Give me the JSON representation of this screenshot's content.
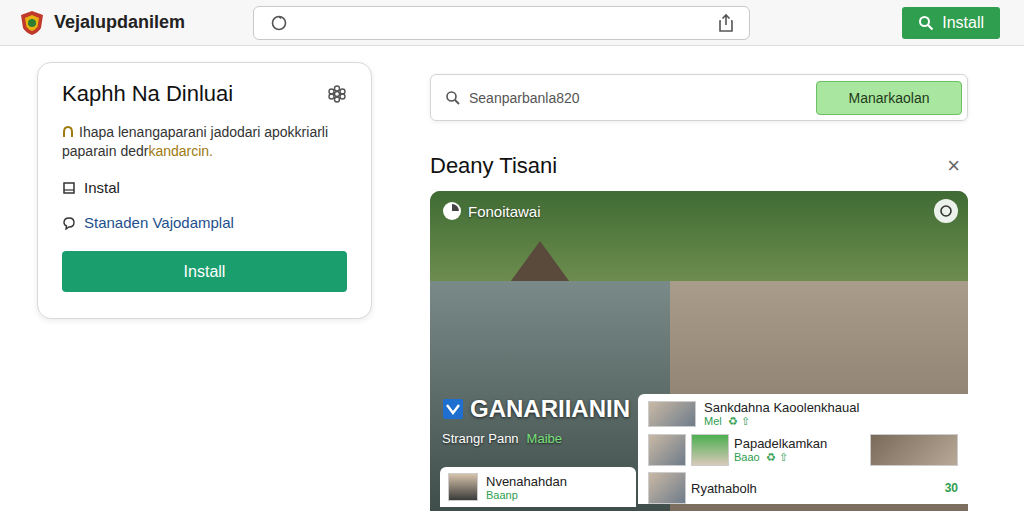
{
  "header": {
    "title": "Vejalupdanilem",
    "install": "Install"
  },
  "promo_card": {
    "title": "Kaphh Na Dinluai",
    "description": "Ihapa lenangaparani jadodari apokkriarli paparain dedr",
    "description_highlight": "kandarcin.",
    "items": [
      {
        "label": "Instal",
        "kind": "box",
        "color": "#222222"
      },
      {
        "label": "Stanaden Vajodamplal",
        "kind": "bubble",
        "color": "#1d4f8c"
      }
    ],
    "button": "Install"
  },
  "search": {
    "placeholder": "Seanparbanla820",
    "button": "Manarkaolan"
  },
  "section": {
    "title": "Deany Tisani",
    "close": "×"
  },
  "feature": {
    "badge": "Fonoitawai",
    "title": "GANARIIANIN",
    "subtitle": "Strangr Pann",
    "subtitle_tag": "Maibe"
  },
  "mini_card": {
    "name": "Nvenahahdan",
    "meta": "Baanp"
  },
  "side_card": {
    "title": "Sankdahna Kaoolenkhaual",
    "meta": "Mel",
    "tags": [
      "♻",
      "⇧"
    ],
    "items": [
      {
        "kind": "media",
        "name": "Papadelkamkan",
        "meta": "Baao",
        "tags": [
          "♻",
          "⇧"
        ]
      },
      {
        "kind": "count",
        "name": "Ryathabolh",
        "count": "30"
      }
    ]
  }
}
